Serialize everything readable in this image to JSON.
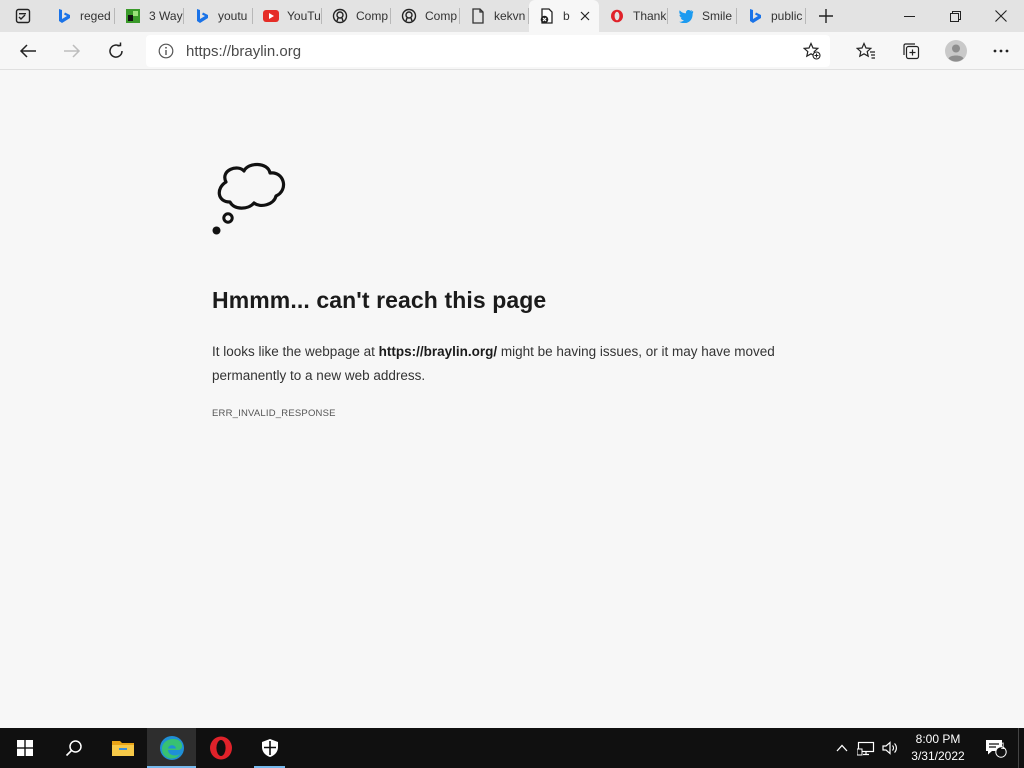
{
  "browser": {
    "tabs": [
      {
        "title": "reged",
        "icon": "bing-icon"
      },
      {
        "title": "3 Way",
        "icon": "green-tile-icon"
      },
      {
        "title": "youtu",
        "icon": "bing-icon"
      },
      {
        "title": "YouTu",
        "icon": "youtube-icon"
      },
      {
        "title": "Comp",
        "icon": "github-icon"
      },
      {
        "title": "Comp",
        "icon": "github-icon"
      },
      {
        "title": "kekvn",
        "icon": "page-icon"
      },
      {
        "title": "b",
        "icon": "error-page-icon",
        "active": true
      },
      {
        "title": "Thank",
        "icon": "opera-icon"
      },
      {
        "title": "Smile",
        "icon": "twitter-icon"
      },
      {
        "title": "public",
        "icon": "bing-icon"
      }
    ],
    "address_bar": {
      "url": "https://braylin.org"
    }
  },
  "error_page": {
    "heading": "Hmmm... can't reach this page",
    "desc_prefix": "It looks like the webpage at ",
    "desc_url": "https://braylin.org/",
    "desc_suffix": " might be having issues, or it may have moved permanently to a new web address.",
    "error_code": "ERR_INVALID_RESPONSE"
  },
  "taskbar": {
    "time": "8:00 PM",
    "date": "3/31/2022",
    "notification_count": "1"
  },
  "colors": {
    "tabstrip": "#e3e3e3",
    "page_bg": "#f7f7f7",
    "taskbar": "#101010",
    "accent": "#76b9ed"
  }
}
